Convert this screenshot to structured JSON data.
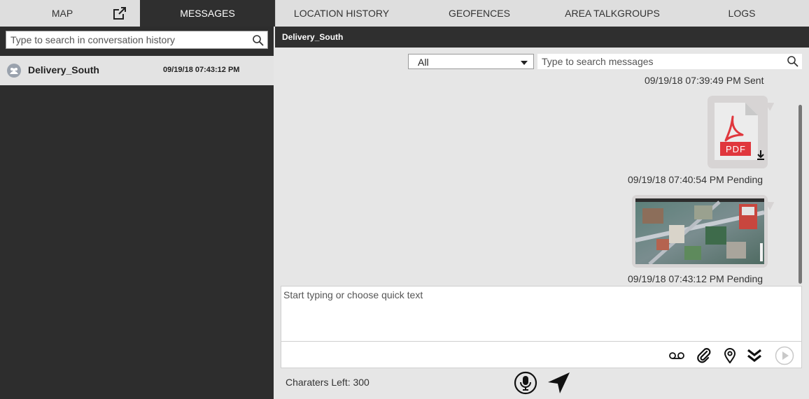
{
  "nav": {
    "tabs": [
      "MAP",
      "MESSAGES",
      "LOCATION HISTORY",
      "GEOFENCES",
      "AREA TALKGROUPS",
      "LOGS"
    ],
    "active_tab": "MESSAGES"
  },
  "sidebar": {
    "search_placeholder": "Type to search in conversation history",
    "conversations": [
      {
        "name": "Delivery_South",
        "time": "09/19/18 07:43:12 PM"
      }
    ]
  },
  "conversation": {
    "title": "Delivery_South",
    "filter_value": "All",
    "search_placeholder": "Type to search messages",
    "messages": [
      {
        "status_line": "09/19/18 07:39:49 PM Sent"
      },
      {
        "attachment": "pdf-file",
        "status_line": "09/19/18 07:40:54 PM Pending"
      },
      {
        "attachment": "aerial-image",
        "status_line": "09/19/18 07:43:12 PM Pending"
      }
    ]
  },
  "pdf_label": "PDF",
  "compose": {
    "placeholder": "Start typing or choose quick text",
    "chars_left": "Charaters Left: 300"
  },
  "icons": [
    "popout-icon",
    "search-icon",
    "voicemail-icon",
    "paperclip-icon",
    "location-pin-icon",
    "double-chevron-down-icon",
    "send-icon",
    "microphone-icon",
    "navigation-arrow-icon"
  ],
  "colors": {
    "dark": "#2f2f2f",
    "pdf_red": "#e0373d",
    "bubble": "#d7d4d4"
  }
}
